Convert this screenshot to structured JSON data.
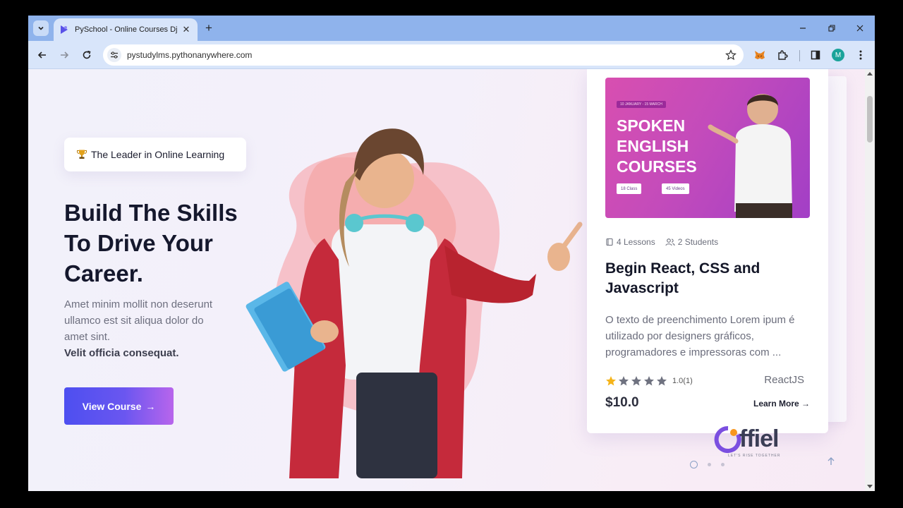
{
  "browser": {
    "tab_title": "PySchool - Online Courses Django",
    "url": "pystudylms.pythonanywhere.com",
    "profile_initial": "M"
  },
  "hero": {
    "badge_text": "The Leader in Online Learning",
    "title": "Build The Skills To Drive Your Career.",
    "description": "Amet minim mollit non deserunt ullamco est sit aliqua dolor do amet sint.",
    "description_strong": "Velit officia consequat.",
    "cta_label": "View Course",
    "cta_arrow": "→"
  },
  "course_card": {
    "thumbnail": {
      "date_tag": "10 JANUARY - 15 MARCH",
      "heading": "SPOKEN ENGLISH COURSES",
      "chip_1": "18 Class",
      "chip_2": "45 Videos"
    },
    "lessons": "4 Lessons",
    "students": "2 Students",
    "title": "Begin React, CSS and Javascript",
    "description": "O texto de preenchimento Lorem ipum é utilizado por designers gráficos, programadores e impressoras com ...",
    "rating": 1.0,
    "rating_text": "1.0(1)",
    "rating_max": 5,
    "category": "ReactJS",
    "price": "$10.0",
    "learn_more": "Learn More →"
  },
  "carousel": {
    "active_index": 0,
    "count": 3
  },
  "watermark": {
    "text": "ffiel",
    "tagline": "LET'S RISE TOGETHER"
  },
  "colors": {
    "accent_gradient_start": "#4d4ff0",
    "accent_gradient_end": "#b865ec",
    "star_filled": "#f5b41a",
    "star_empty": "#6f7280"
  }
}
